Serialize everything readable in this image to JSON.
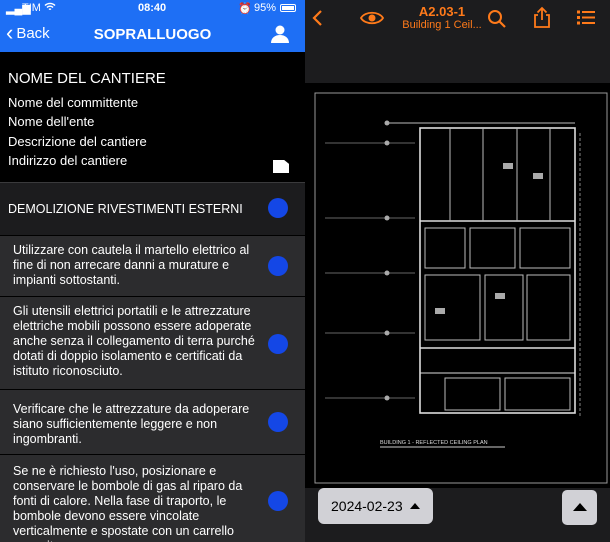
{
  "status": {
    "carrier": "TIM",
    "time": "08:40",
    "battery": "95%"
  },
  "nav": {
    "back_label": "Back",
    "title": "SOPRALLUOGO"
  },
  "project": {
    "name": "NOME DEL CANTIERE",
    "fields": [
      "Nome del committente",
      "Nome dell'ente",
      "Descrizione del cantiere",
      "Indirizzo del cantiere"
    ]
  },
  "section": {
    "title": "DEMOLIZIONE RIVESTIMENTI ESTERNI"
  },
  "items": [
    "Utilizzare con cautela il martello elettrico al fine di non arrecare danni a murature e impianti sottostanti.",
    "Gli utensili elettrici portatili e le attrezzature elettriche mobili possono essere adoperate anche senza il collegamento di terra purché dotati di doppio isolamento e certificati da istituto riconosciuto.",
    "Verificare che le attrezzature da adoperare siano sufficientemente leggere e non ingombranti.",
    "Se ne è richiesto l'uso, posizionare e conservare le bombole di gas al riparo da fonti di calore. Nella fase di traporto, le bombole devono essere vincolate verticalmente e spostate con un carrello apposito."
  ],
  "viewer": {
    "sheet_code": "A2.03-1",
    "sheet_name": "Building 1 Ceil...",
    "plan_title": "BUILDING 1 - REFLECTED CEILING PLAN",
    "date": "2024-02-23",
    "accent": "#ff7a1a"
  },
  "colors": {
    "nav_blue": "#1e6ff5",
    "dot_blue": "#1447e6"
  }
}
